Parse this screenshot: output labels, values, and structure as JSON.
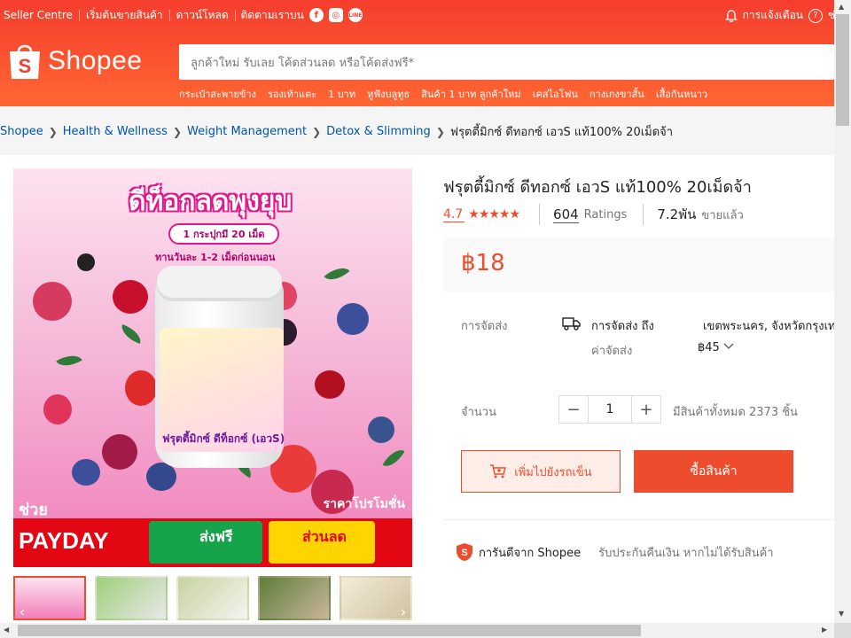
{
  "header": {
    "links": [
      "Seller Centre",
      "เริ่มต้นขายสินค้า",
      "ดาวน์โหลด"
    ],
    "follow_label": "ติดตามเราบน",
    "notifications_label": "การแจ้งเตือน",
    "help_label": "ช่วยเ",
    "logo_text": "Shopee",
    "search_placeholder": "ลูกค้าใหม่ รับเลย โค้ดส่วนลด หรือโค้ดส่งฟรี*",
    "suggestions": [
      "กระเป๋าสะพายข้าง",
      "รองเท้าแตะ",
      "1 บาท",
      "หูฟังบลูทูธ",
      "สินค้า 1 บาท ลูกค้าใหม่",
      "เคสไอโฟน",
      "กางเกงขาสั้น",
      "เสื้อกันหนาว"
    ]
  },
  "breadcrumb": {
    "items": [
      "Shopee",
      "Health & Wellness",
      "Weight Management",
      "Detox & Slimming"
    ],
    "current": "ฟรุตตี้มิกซ์ ดีทอกซ์ เอวS แท้100% 20เม็ดจ้า"
  },
  "product": {
    "title": "ฟรุตตี้มิกซ์ ดีทอกซ์ เอวS แท้100% 20เม็ดจ้า",
    "rating": "4.7",
    "stars": "★★★★★",
    "ratings_count": "604",
    "ratings_label": "Ratings",
    "sold_count": "7.2พัน",
    "sold_label": "ขายแล้ว",
    "price": "฿18",
    "image_text": {
      "headline": "ดีท็อกลดพุงยุบ",
      "pill": "1 กระปุกมี 20 เม็ด",
      "dosage": "ทานวันละ 1-2 เม็ดก่อนนอน",
      "jar_label": "ฟรุตตี้มิกซ์ ดีท็อกซ์ (เอวS)",
      "help_word": "ช่วย",
      "promo": "ราคาโปรโมชั่น",
      "payday": "PAYDAY",
      "free_ship": "ส่งฟรี",
      "discount": "ส่วนลด"
    }
  },
  "shipping": {
    "label": "การจัดส่ง",
    "to_label": "การจัดส่ง ถึง",
    "location": "เขตพระนคร, จังหวัดกรุงเท",
    "fee_label": "ค่าจัดส่ง",
    "fee": "฿45"
  },
  "quantity": {
    "label": "จำนวน",
    "value": "1",
    "available": "มีสินค้าทั้งหมด 2373 ชิ้น"
  },
  "actions": {
    "add_to_cart": "เพิ่มไปยังรถเข็น",
    "buy_now": "ซื้อสินค้า"
  },
  "guarantee": {
    "title": "การันตีจาก Shopee",
    "desc": "รับประกันคืนเงิน หากไม่ได้รับสินค้า"
  },
  "colors": {
    "brand": "#ee4d2d",
    "link": "#0055aa"
  }
}
